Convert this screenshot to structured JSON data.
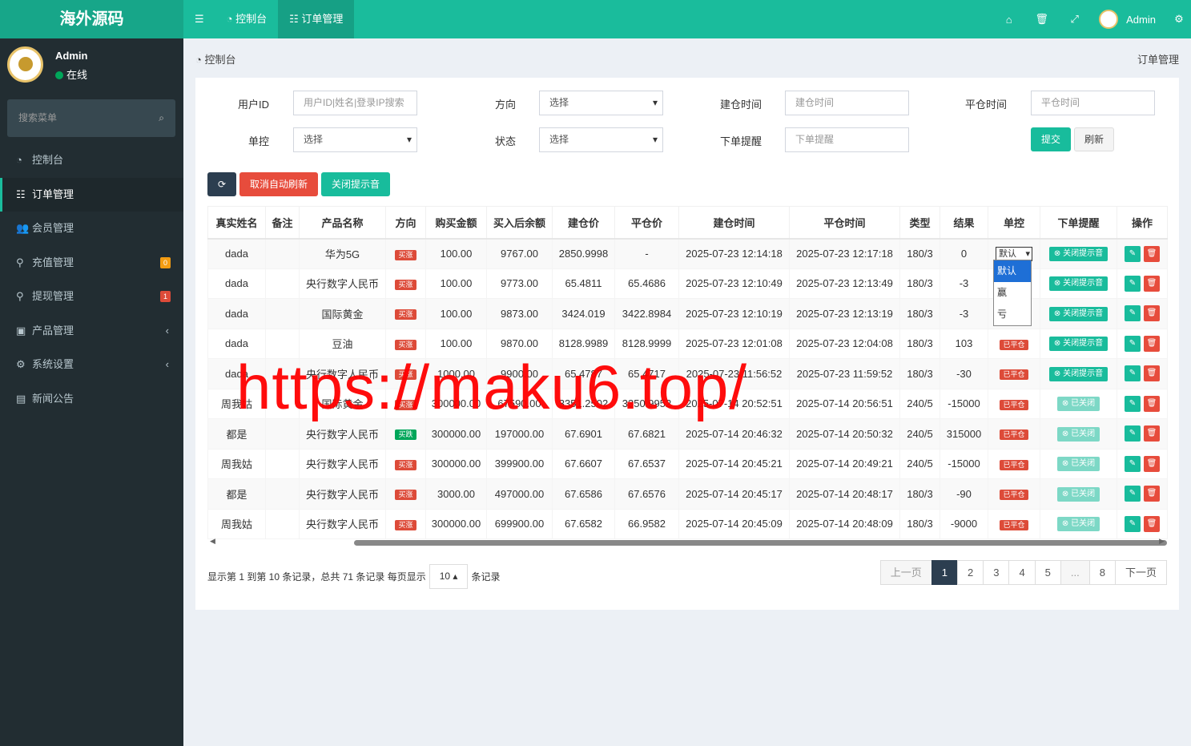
{
  "brand": "海外源码",
  "topnav": [
    {
      "icon": "menu-icon",
      "label": "≡"
    },
    {
      "icon": "dashboard-icon",
      "label": "控制台"
    },
    {
      "icon": "list-icon",
      "label": "订单管理"
    }
  ],
  "topbar": {
    "user": "Admin"
  },
  "sidebar": {
    "user": {
      "name": "Admin",
      "status": "在线"
    },
    "search_placeholder": "搜索菜单",
    "items": [
      {
        "label": "控制台",
        "icon": "dashboard-icon"
      },
      {
        "label": "订单管理",
        "icon": "list-icon"
      },
      {
        "label": "会员管理",
        "icon": "users-icon"
      },
      {
        "label": "充值管理",
        "icon": "recharge-icon",
        "badge": "0"
      },
      {
        "label": "提现管理",
        "icon": "withdraw-icon",
        "badge": "1"
      },
      {
        "label": "产品管理",
        "icon": "briefcase-icon",
        "chevron": "‹"
      },
      {
        "label": "系统设置",
        "icon": "cogs-icon",
        "chevron": "‹"
      },
      {
        "label": "新闻公告",
        "icon": "newspaper-icon"
      }
    ]
  },
  "breadcrumb": {
    "home": "控制台",
    "current": "订单管理"
  },
  "filters": {
    "user_id": {
      "label": "用户ID",
      "placeholder": "用户ID|姓名|登录IP搜索"
    },
    "direction": {
      "label": "方向",
      "value": "选择"
    },
    "open_time": {
      "label": "建仓时间",
      "placeholder": "建仓时间"
    },
    "close_time": {
      "label": "平仓时间",
      "placeholder": "平仓时间"
    },
    "control": {
      "label": "单控",
      "value": "选择"
    },
    "status": {
      "label": "状态",
      "value": "选择"
    },
    "reminder": {
      "label": "下单提醒",
      "placeholder": "下单提醒"
    },
    "submit": "提交",
    "reset": "刷新"
  },
  "toolbar": {
    "refresh_icon": "refresh-icon",
    "cancel_auto": "取消自动刷新",
    "mute": "关闭提示音"
  },
  "table": {
    "headers": [
      "真实姓名",
      "备注",
      "产品名称",
      "方向",
      "购买金额",
      "买入后余额",
      "建仓价",
      "平仓价",
      "建仓时间",
      "平仓时间",
      "类型",
      "结果",
      "单控",
      "下单提醒",
      "操作"
    ],
    "rows": [
      {
        "name": "dada",
        "note": "",
        "product": "华为5G",
        "dir": "买涨",
        "amount": "100.00",
        "balance": "9767.00",
        "open": "2850.9998",
        "close": "-",
        "otime": "2025-07-23 12:14:18",
        "ctime": "2025-07-23 12:17:18",
        "type": "180/3",
        "result": "0",
        "ctrl": "select",
        "remind": "关闭提示音"
      },
      {
        "name": "dada",
        "note": "",
        "product": "央行数字人民币",
        "dir": "买涨",
        "amount": "100.00",
        "balance": "9773.00",
        "open": "65.4811",
        "close": "65.4686",
        "otime": "2025-07-23 12:10:49",
        "ctime": "2025-07-23 12:13:49",
        "type": "180/3",
        "result": "-3",
        "ctrl": "",
        "remind": "关闭提示音"
      },
      {
        "name": "dada",
        "note": "",
        "product": "国际黄金",
        "dir": "买涨",
        "amount": "100.00",
        "balance": "9873.00",
        "open": "3424.019",
        "close": "3422.8984",
        "otime": "2025-07-23 12:10:19",
        "ctime": "2025-07-23 12:13:19",
        "type": "180/3",
        "result": "-3",
        "ctrl": "",
        "remind": "关闭提示音"
      },
      {
        "name": "dada",
        "note": "",
        "product": "豆油",
        "dir": "买涨",
        "amount": "100.00",
        "balance": "9870.00",
        "open": "8128.9989",
        "close": "8128.9999",
        "otime": "2025-07-23 12:01:08",
        "ctime": "2025-07-23 12:04:08",
        "type": "180/3",
        "result": "103",
        "ctrl": "已平仓",
        "remind": "关闭提示音"
      },
      {
        "name": "dada",
        "note": "",
        "product": "央行数字人民币",
        "dir": "买涨",
        "amount": "1000.00",
        "balance": "9900.00",
        "open": "65.4787",
        "close": "65.4717",
        "otime": "2025-07-23 11:56:52",
        "ctime": "2025-07-23 11:59:52",
        "type": "180/3",
        "result": "-30",
        "ctrl": "已平仓",
        "remind": "关闭提示音"
      },
      {
        "name": "周我姑",
        "note": "",
        "product": "国际黄金",
        "dir": "买涨",
        "amount": "300000.00",
        "balance": "67590.00",
        "open": "3351.2502",
        "close": "3350.9952",
        "otime": "2025-07-14 20:52:51",
        "ctime": "2025-07-14 20:56:51",
        "type": "240/5",
        "result": "-15000",
        "ctrl": "已平仓",
        "remind": "已关闭"
      },
      {
        "name": "都是",
        "note": "",
        "product": "央行数字人民币",
        "dir": "买跌",
        "amount": "300000.00",
        "balance": "197000.00",
        "open": "67.6901",
        "close": "67.6821",
        "otime": "2025-07-14 20:46:32",
        "ctime": "2025-07-14 20:50:32",
        "type": "240/5",
        "result": "315000",
        "ctrl": "已平仓",
        "remind": "已关闭"
      },
      {
        "name": "周我姑",
        "note": "",
        "product": "央行数字人民币",
        "dir": "买涨",
        "amount": "300000.00",
        "balance": "399900.00",
        "open": "67.6607",
        "close": "67.6537",
        "otime": "2025-07-14 20:45:21",
        "ctime": "2025-07-14 20:49:21",
        "type": "240/5",
        "result": "-15000",
        "ctrl": "已平仓",
        "remind": "已关闭"
      },
      {
        "name": "都是",
        "note": "",
        "product": "央行数字人民币",
        "dir": "买涨",
        "amount": "3000.00",
        "balance": "497000.00",
        "open": "67.6586",
        "close": "67.6576",
        "otime": "2025-07-14 20:45:17",
        "ctime": "2025-07-14 20:48:17",
        "type": "180/3",
        "result": "-90",
        "ctrl": "已平仓",
        "remind": "已关闭"
      },
      {
        "name": "周我姑",
        "note": "",
        "product": "央行数字人民币",
        "dir": "买涨",
        "amount": "300000.00",
        "balance": "699900.00",
        "open": "67.6582",
        "close": "66.9582",
        "otime": "2025-07-14 20:45:09",
        "ctime": "2025-07-14 20:48:09",
        "type": "180/3",
        "result": "-9000",
        "ctrl": "已平仓",
        "remind": "已关闭"
      }
    ]
  },
  "control_dropdown": {
    "current": "默认",
    "options": [
      "默认",
      "赢",
      "亏"
    ]
  },
  "pagination": {
    "info_prefix": "显示第 1 到第 10 条记录，总共 71 条记录 每页显示",
    "page_size": "10",
    "info_suffix": "条记录",
    "prev": "上一页",
    "pages": [
      "1",
      "2",
      "3",
      "4",
      "5",
      "...",
      "8"
    ],
    "current": "1",
    "next": "下一页"
  },
  "watermark": "https://maku6.top/",
  "colors": {
    "primary": "#1abc9c",
    "sidebar": "#222d32",
    "danger": "#dd4b39",
    "dark": "#2c3e50"
  }
}
